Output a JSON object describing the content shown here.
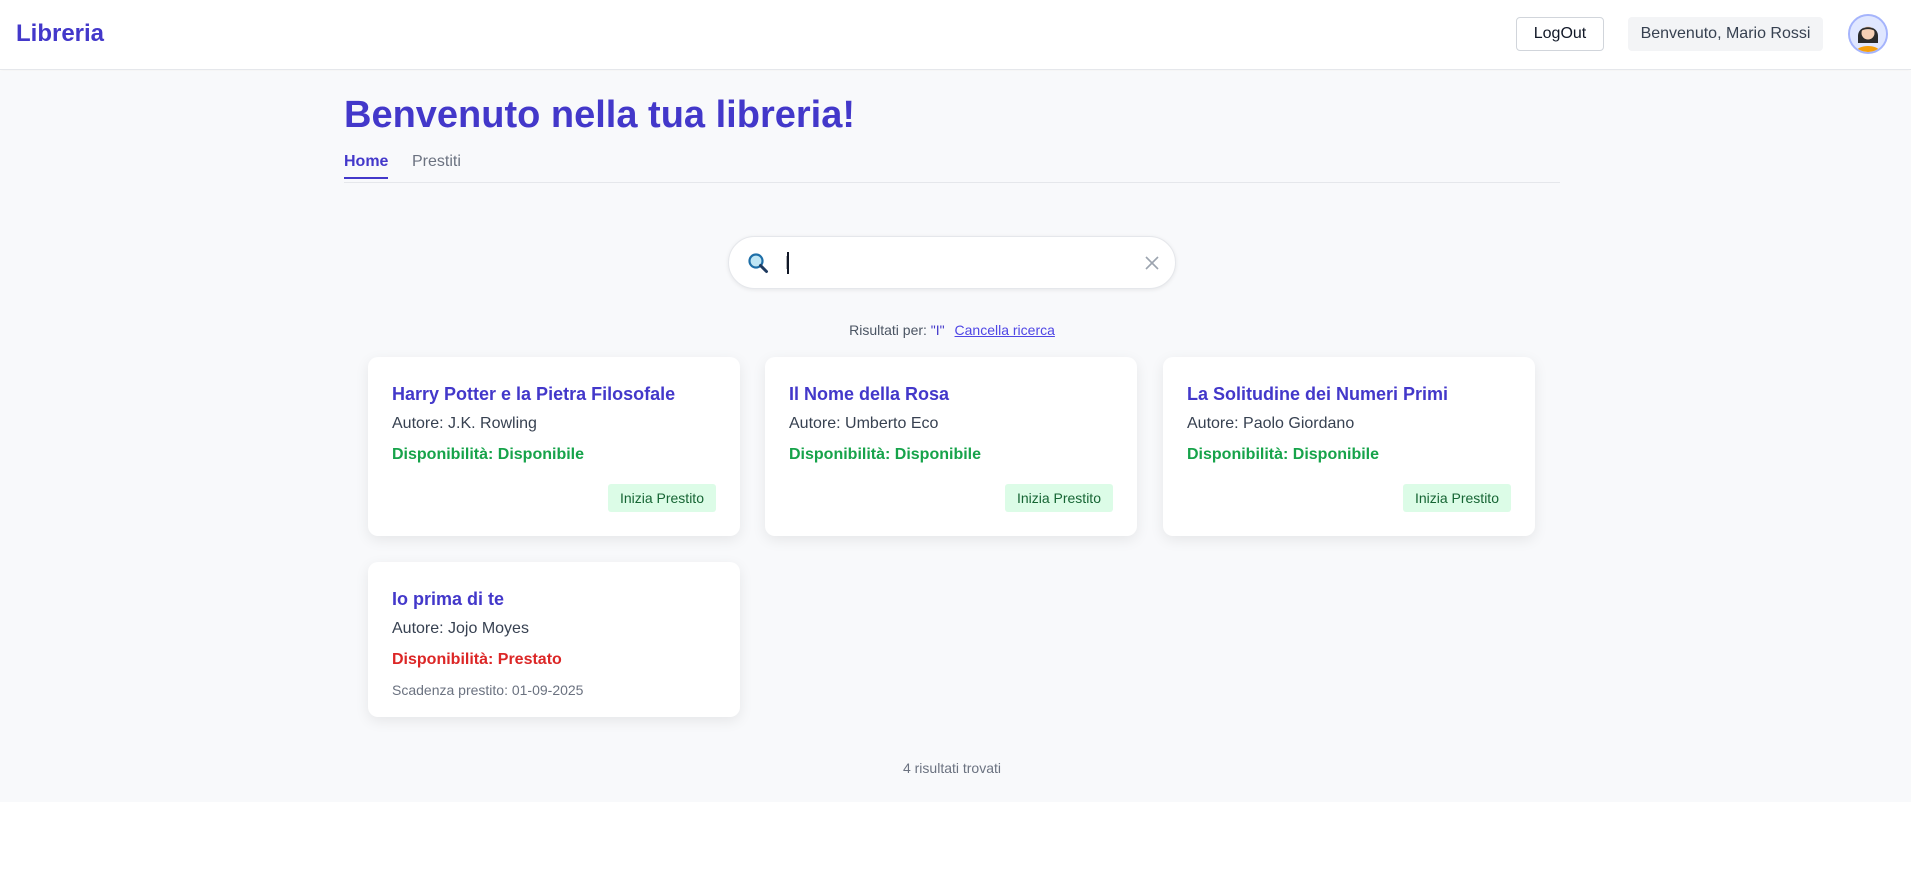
{
  "header": {
    "brand": "Libreria",
    "logout_label": "LogOut",
    "welcome": "Benvenuto, Mario Rossi",
    "avatar_icon": "user-avatar-icon"
  },
  "page": {
    "title": "Benvenuto nella tua libreria!",
    "tabs": [
      {
        "label": "Home",
        "active": true
      },
      {
        "label": "Prestiti",
        "active": false
      }
    ]
  },
  "search": {
    "icon": "search-icon",
    "value": "I",
    "clear_icon": "close-icon"
  },
  "results": {
    "prefix": "Risultati per:",
    "query_display": "\"I\"",
    "cancel_label": "Cancella ricerca",
    "count_text": "4 risultati trovati"
  },
  "books": [
    {
      "title": "Harry Potter e la Pietra Filosofale",
      "author": "Autore: J.K. Rowling",
      "availability": "Disponibilità: Disponibile",
      "status": "available",
      "action": "Inizia Prestito"
    },
    {
      "title": "Il Nome della Rosa",
      "author": "Autore: Umberto Eco",
      "availability": "Disponibilità: Disponibile",
      "status": "available",
      "action": "Inizia Prestito"
    },
    {
      "title": "La Solitudine dei Numeri Primi",
      "author": "Autore: Paolo Giordano",
      "availability": "Disponibilità: Disponibile",
      "status": "available",
      "action": "Inizia Prestito"
    },
    {
      "title": "Io prima di te",
      "author": "Autore: Jojo Moyes",
      "availability": "Disponibilità: Prestato",
      "status": "loaned",
      "due": "Scadenza prestito: 01-09-2025"
    }
  ],
  "colors": {
    "accent": "#4338ca",
    "available": "#16a34a",
    "loaned": "#dc2626",
    "button_bg": "#dcfce7"
  }
}
